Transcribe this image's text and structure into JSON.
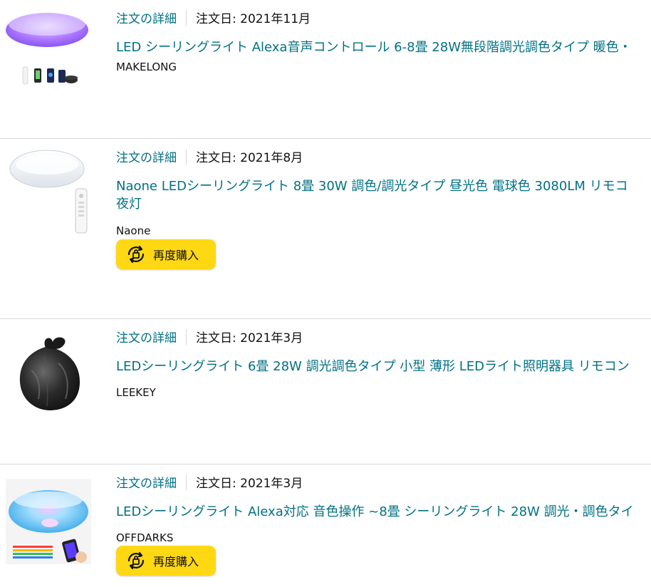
{
  "orders": [
    {
      "detail_link": "注文の詳細",
      "date_label": "注文日: 2021年11月",
      "title_lines": [
        "LED シーリングライト Alexa音声コントロール 6-8畳 28W無段階調光調色タイプ 暖色・"
      ],
      "brand": "MAKELONG",
      "image_icon": "ceiling-light-purple-image"
    },
    {
      "detail_link": "注文の詳細",
      "date_label": "注文日: 2021年8月",
      "title_lines": [
        "Naone LEDシーリングライト 8畳 30W 調色/調光タイプ 昼光色 電球色 3080LM リモコ",
        "夜灯"
      ],
      "brand": "Naone",
      "buy_again_label": "再度購入",
      "image_icon": "ceiling-light-white-remote-image"
    },
    {
      "detail_link": "注文の詳細",
      "date_label": "注文日: 2021年3月",
      "title_lines": [
        "LEDシーリングライト 6畳 28W 調光調色タイプ 小型 薄形 LEDライト照明器具 リモコン"
      ],
      "brand": "LEEKEY",
      "image_icon": "black-garbage-bag-image"
    },
    {
      "detail_link": "注文の詳細",
      "date_label": "注文日: 2021年3月",
      "title_lines": [
        "LEDシーリングライト Alexa対応 音色操作 ~8畳 シーリングライト 28W 調光・調色タイ"
      ],
      "brand": "OFFDARKS",
      "buy_again_label": "再度購入",
      "image_icon": "ceiling-light-rgb-phone-image"
    }
  ],
  "colors": {
    "link": "#007185",
    "button": "#ffd814",
    "divider": "#d5d9d9",
    "text": "#0f1111"
  }
}
